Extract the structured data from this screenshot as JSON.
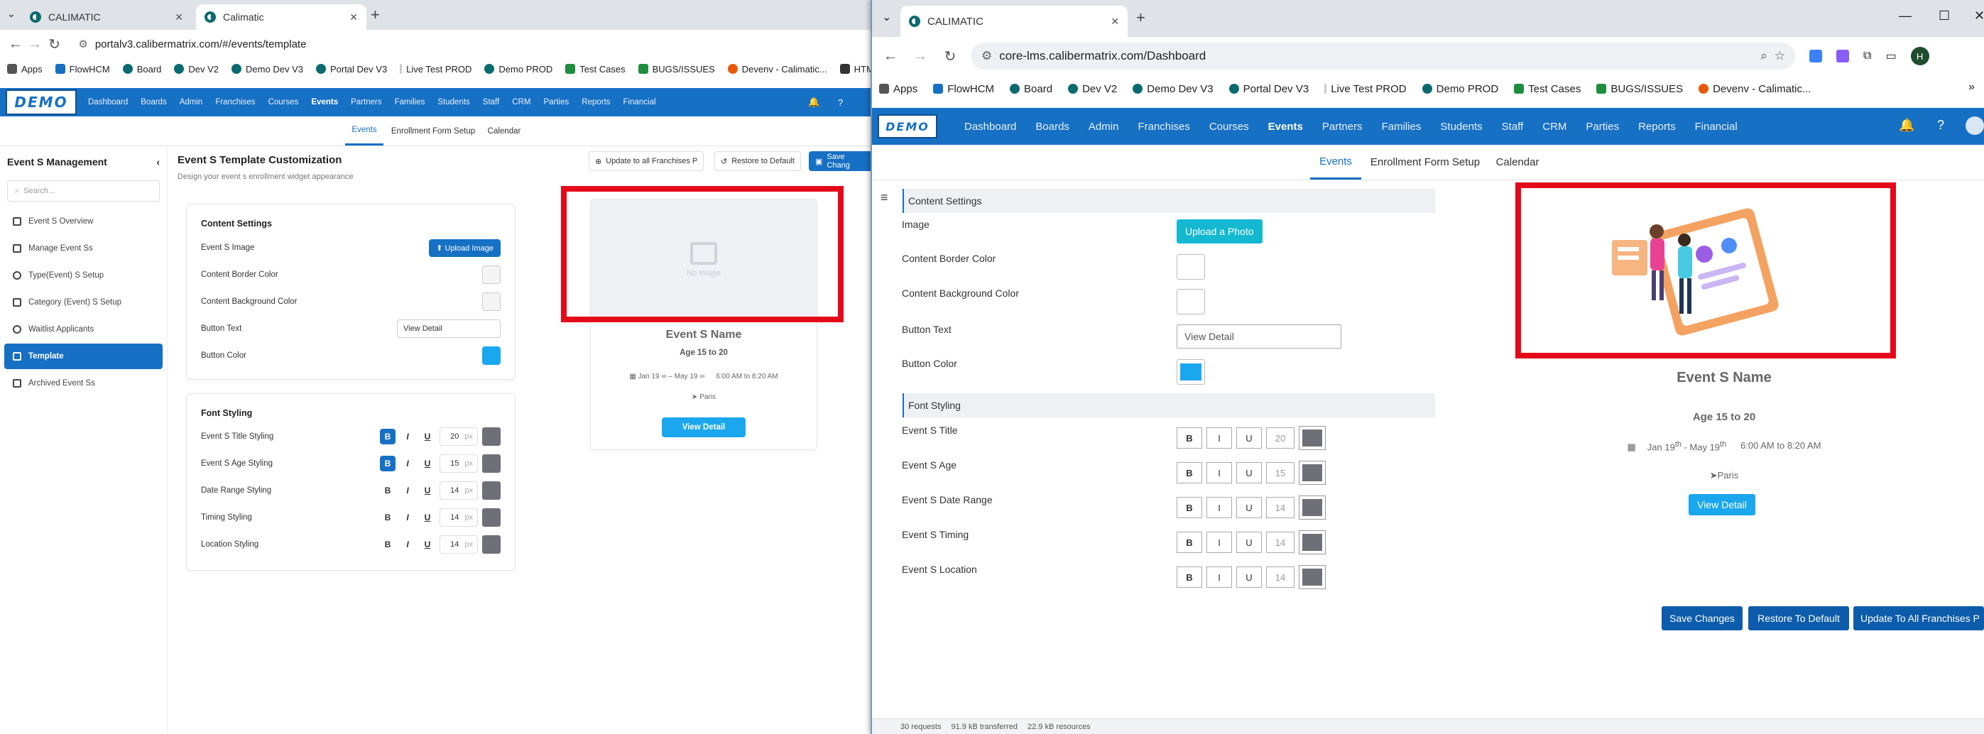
{
  "left": {
    "tabs": [
      {
        "title": "CALIMATIC"
      },
      {
        "title": "Calimatic"
      }
    ],
    "url": "portalv3.calibermatrix.com/#/events/template",
    "bookmarks": [
      "Apps",
      "FlowHCM",
      "Board",
      "Dev V2",
      "Demo Dev V3",
      "Portal Dev V3",
      "Live Test PROD",
      "Demo PROD",
      "Test Cases",
      "BUGS/ISSUES",
      "Devenv - Calimatic...",
      "HTML El"
    ],
    "logo": "DEMO",
    "nav": [
      "Dashboard",
      "Boards",
      "Admin",
      "Franchises",
      "Courses",
      "Events",
      "Partners",
      "Families",
      "Students",
      "Staff",
      "CRM",
      "Parties",
      "Reports",
      "Financial"
    ],
    "subnav": [
      "Events",
      "Enrollment Form Setup",
      "Calendar"
    ],
    "sidebar": {
      "title": "Event S Management",
      "search_placeholder": "Search...",
      "items": [
        "Event S Overview",
        "Manage Event Ss",
        "Type(Event) S Setup",
        "Category (Event) S Setup",
        "Waitlist Applicants",
        "Template",
        "Archived Event Ss"
      ]
    },
    "page_title": "Event S Template Customization",
    "page_subtitle": "Design your event s enrollment widget appearance",
    "buttons": {
      "update_all": "Update to all Franchises P",
      "restore": "Restore to Default",
      "save": "Save Chang"
    },
    "content_settings": {
      "title": "Content Settings",
      "image_label": "Event S Image",
      "upload": "Upload Image",
      "border_label": "Content Border Color",
      "bg_label": "Content Background Color",
      "btn_text_label": "Button Text",
      "btn_text_value": "View Detail",
      "btn_color_label": "Button Color",
      "btn_color": "#1aa7ee"
    },
    "font_styling": {
      "title": "Font Styling",
      "rows": [
        {
          "label": "Event S Title Styling",
          "size": "20",
          "unit": "px"
        },
        {
          "label": "Event S Age Styling",
          "size": "15",
          "unit": "px"
        },
        {
          "label": "Date Range Styling",
          "size": "14",
          "unit": "px"
        },
        {
          "label": "Timing Styling",
          "size": "14",
          "unit": "px"
        },
        {
          "label": "Location Styling",
          "size": "14",
          "unit": "px"
        }
      ]
    },
    "preview": {
      "no_image": "No Image",
      "name": "Event S Name",
      "age": "Age 15 to 20",
      "dates": "Jan 19 ∞ – May 19 ∞",
      "time": "6:00 AM to 8:20 AM",
      "location": "Paris",
      "button": "View Detail"
    }
  },
  "right": {
    "tab": "CALIMATIC",
    "url": "core-lms.calibermatrix.com/Dashboard",
    "bookmarks": [
      "Apps",
      "FlowHCM",
      "Board",
      "Dev V2",
      "Demo Dev V3",
      "Portal Dev V3",
      "Live Test PROD",
      "Demo PROD",
      "Test Cases",
      "BUGS/ISSUES",
      "Devenv - Calimatic..."
    ],
    "logo": "DEMO",
    "nav": [
      "Dashboard",
      "Boards",
      "Admin",
      "Franchises",
      "Courses",
      "Events",
      "Partners",
      "Families",
      "Students",
      "Staff",
      "CRM",
      "Parties",
      "Reports",
      "Financial"
    ],
    "subnav": [
      "Events",
      "Enrollment Form Setup",
      "Calendar"
    ],
    "content_settings": {
      "title": "Content Settings",
      "image_label": "Image",
      "upload": "Upload a Photo",
      "border_label": "Content Border Color",
      "bg_label": "Content Background Color",
      "btn_text_label": "Button Text",
      "btn_text_value": "View Detail",
      "btn_color_label": "Button Color"
    },
    "font_styling": {
      "title": "Font Styling",
      "rows": [
        {
          "label": "Event S Title",
          "size": "20"
        },
        {
          "label": "Event S Age",
          "size": "15"
        },
        {
          "label": "Event S Date Range",
          "size": "14"
        },
        {
          "label": "Event S Timing",
          "size": "14"
        },
        {
          "label": "Event S Location",
          "size": "14"
        }
      ]
    },
    "preview": {
      "name": "Event S Name",
      "age": "Age 15 to 20",
      "date_start": "Jan 19",
      "date_start_sup": "th",
      "date_mid": " - May 19",
      "date_end_sup": "th",
      "time": "6:00 AM to 8:20 AM",
      "location": "Paris",
      "button": "View Detail"
    },
    "buttons": {
      "save": "Save Changes",
      "restore": "Restore To Default",
      "update_all": "Update To All Franchises P"
    },
    "devtools": {
      "requests": "30 requests",
      "transferred": "91.9 kB transferred",
      "resources": "22.9 kB resources"
    }
  },
  "colors": {
    "brand": "#1670c4",
    "accent": "#1aa7ee",
    "highlight": "#e4091a"
  }
}
